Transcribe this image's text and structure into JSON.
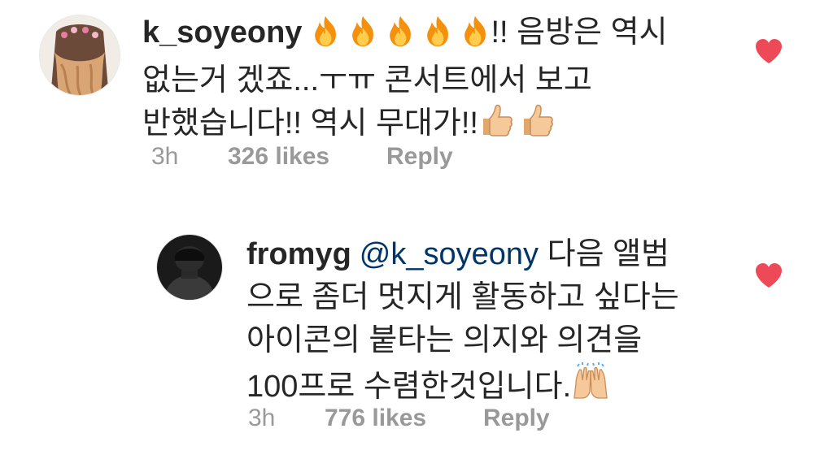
{
  "comments": [
    {
      "username": "k_soyeony",
      "lines": [
        "!! 음방은 역시",
        "없는거 겠죠...ㅜㅠ 콘서트에서 보고",
        "반했습니다!! 역시 무대가!!"
      ],
      "emoji_prefix": [
        "fire-icon",
        "fire-icon",
        "fire-icon",
        "fire-icon",
        "fire-icon"
      ],
      "emoji_suffix": [
        "thumbs-up-icon",
        "thumbs-up-icon"
      ],
      "time": "3h",
      "likes": "326 likes",
      "reply_label": "Reply",
      "liked": true
    },
    {
      "username": "fromyg",
      "mention": "@k_soyeony",
      "lines": [
        "다음 앨범",
        "으로 좀더 멋지게 활동하고 싶다는",
        "아이콘의 붙타는 의지와 의견을",
        "100프로 수렴한것입니다."
      ],
      "emoji_suffix": [
        "raised-hands-icon"
      ],
      "time": "3h",
      "likes": "776 likes",
      "reply_label": "Reply",
      "liked": true
    }
  ],
  "colors": {
    "heart": "#ed4956",
    "meta": "#999999",
    "mention": "#003569",
    "text": "#262626"
  }
}
